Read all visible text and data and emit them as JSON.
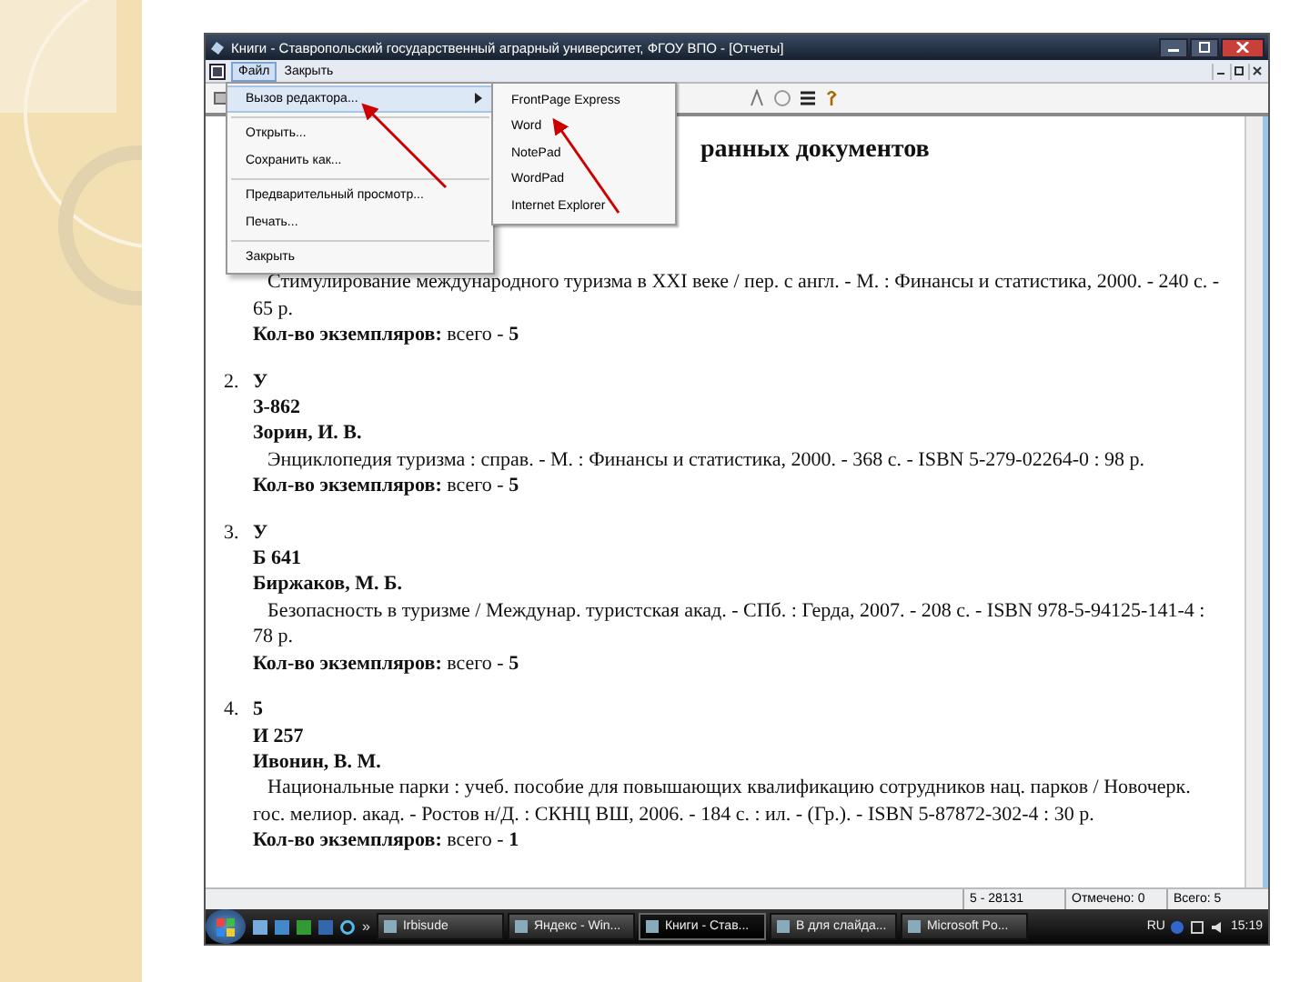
{
  "window": {
    "title": "Книги - Ставропольский государственный аграрный университет, ФГОУ ВПО - [Отчеты]"
  },
  "menu_bar": {
    "items": [
      {
        "label": "Файл",
        "selected": true
      },
      {
        "label": "Закрыть",
        "selected": false
      }
    ]
  },
  "file_menu": {
    "items": [
      {
        "kind": "item",
        "label": "Вызов редактора...",
        "has_submenu": true,
        "selected": true
      },
      {
        "kind": "separator"
      },
      {
        "kind": "item",
        "label": "Открыть...",
        "has_submenu": false,
        "selected": false
      },
      {
        "kind": "item",
        "label": "Сохранить как...",
        "has_submenu": false,
        "selected": false
      },
      {
        "kind": "separator"
      },
      {
        "kind": "item",
        "label": "Предварительный просмотр...",
        "has_submenu": false,
        "selected": false
      },
      {
        "kind": "item",
        "label": "Печать...",
        "has_submenu": false,
        "selected": false
      },
      {
        "kind": "separator"
      },
      {
        "kind": "item",
        "label": "Закрыть",
        "has_submenu": false,
        "selected": false
      }
    ]
  },
  "editor_submenu": {
    "items": [
      {
        "label": "FrontPage Express",
        "selected": false
      },
      {
        "label": "Word",
        "selected": false
      },
      {
        "label": "NotePad",
        "selected": false
      },
      {
        "label": "WordPad",
        "selected": false
      },
      {
        "label": "Internet Explorer",
        "selected": false
      }
    ]
  },
  "document": {
    "heading": "ранных документов",
    "records": [
      {
        "lines": [
          {
            "kind": "annotation",
            "text": "Стимулирование международного туризма в XXI веке / пер. с англ. - М. : Финансы и статистика, 2000. - 240 с. - 65 р."
          },
          {
            "kind": "count",
            "text": "**Кол-во экземпляров:** всего - **5**"
          }
        ]
      },
      {
        "number": "2.",
        "lines": [
          {
            "kind": "bold",
            "text": "У"
          },
          {
            "kind": "bold",
            "text": "З-862"
          },
          {
            "kind": "bold",
            "text": "Зорин, И. В."
          },
          {
            "kind": "annotation",
            "text": "Энциклопедия туризма : справ. - М. : Финансы и статистика, 2000. - 368 с. - ISBN 5-279-02264-0 : 98 р."
          },
          {
            "kind": "count",
            "text": "**Кол-во экземпляров:** всего - **5**"
          }
        ]
      },
      {
        "number": "3.",
        "lines": [
          {
            "kind": "bold",
            "text": "У"
          },
          {
            "kind": "bold",
            "text": "Б 641"
          },
          {
            "kind": "bold",
            "text": "Биржаков, М. Б."
          },
          {
            "kind": "annotation",
            "text": "Безопасность в туризме / Междунар. туристская акад. - СПб. : Герда, 2007. - 208 с. - ISBN 978-5-94125-141-4 : 78 р."
          },
          {
            "kind": "count",
            "text": "**Кол-во экземпляров:** всего - **5**"
          }
        ]
      },
      {
        "number": "4.",
        "lines": [
          {
            "kind": "bold",
            "text": "5"
          },
          {
            "kind": "bold",
            "text": "И 257"
          },
          {
            "kind": "bold",
            "text": "Ивонин, В. М."
          },
          {
            "kind": "annotation",
            "text": "Национальные парки : учеб. пособие для повышающих квалификацию сотрудников нац. парков / Новочерк. гос. мелиор. акад. - Ростов н/Д. : СКНЦ ВШ, 2006. - 184 с. : ил. - (Гр.). - ISBN 5-87872-302-4 : 30 р."
          },
          {
            "kind": "count",
            "text": "**Кол-во экземпляров:** всего - **1**"
          }
        ]
      }
    ]
  },
  "status_bar": [
    "5 - 28131",
    "Отмечено: 0",
    "Всего: 5"
  ],
  "taskbar": {
    "overflow": "»",
    "tasks": [
      {
        "label": "Irbisude",
        "selected": false
      },
      {
        "label": "Яндекс - Win...",
        "selected": false
      },
      {
        "label": "Книги - Став...",
        "selected": true
      },
      {
        "label": "В для слайда...",
        "selected": false
      },
      {
        "label": "Microsoft Po...",
        "selected": false
      }
    ],
    "language": "RU",
    "clock": "15:19"
  }
}
